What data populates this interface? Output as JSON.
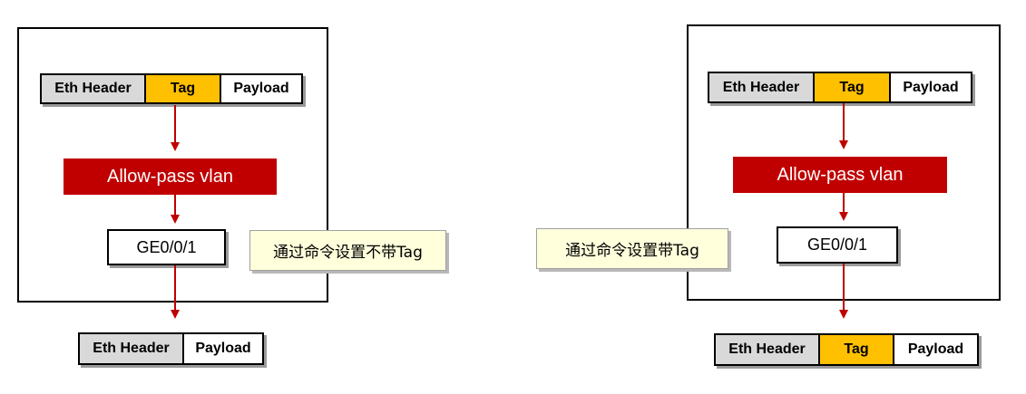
{
  "left": {
    "ingress_frame": [
      "Eth Header",
      "Tag",
      "Payload"
    ],
    "vlan_label": "Allow-pass vlan",
    "port_label": "GE0/0/1",
    "note": "通过命令设置不带Tag",
    "egress_frame": [
      "Eth Header",
      "Payload"
    ]
  },
  "right": {
    "ingress_frame": [
      "Eth Header",
      "Tag",
      "Payload"
    ],
    "vlan_label": "Allow-pass vlan",
    "port_label": "GE0/0/1",
    "note": "通过命令设置带Tag",
    "egress_frame": [
      "Eth Header",
      "Tag",
      "Payload"
    ]
  },
  "colors": {
    "eth_header": "#d9d9d9",
    "tag": "#ffc000",
    "payload": "#ffffff",
    "vlan_bar": "#c00000",
    "arrow": "#c00000",
    "note_bg": "#ffffdc"
  }
}
